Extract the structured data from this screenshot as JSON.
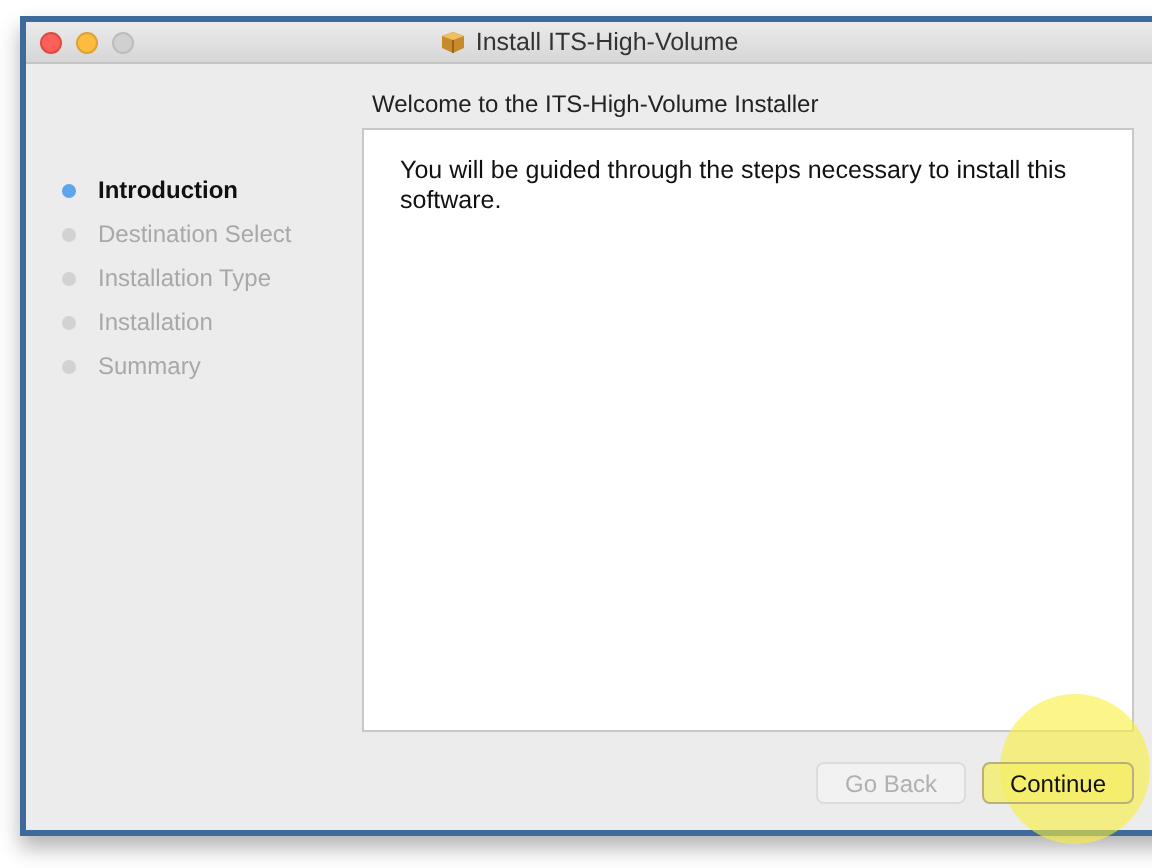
{
  "window": {
    "title": "Install ITS-High-Volume"
  },
  "steps": [
    {
      "label": "Introduction",
      "selected": true
    },
    {
      "label": "Destination Select",
      "selected": false
    },
    {
      "label": "Installation Type",
      "selected": false
    },
    {
      "label": "Installation",
      "selected": false
    },
    {
      "label": "Summary",
      "selected": false
    }
  ],
  "heading": "Welcome to the ITS-High-Volume Installer",
  "body": "You will be guided through the steps necessary to install this software.",
  "buttons": [
    {
      "label": "Go Back",
      "disabled": true,
      "highlighted": false
    },
    {
      "label": "Continue",
      "disabled": false,
      "highlighted": true
    }
  ]
}
